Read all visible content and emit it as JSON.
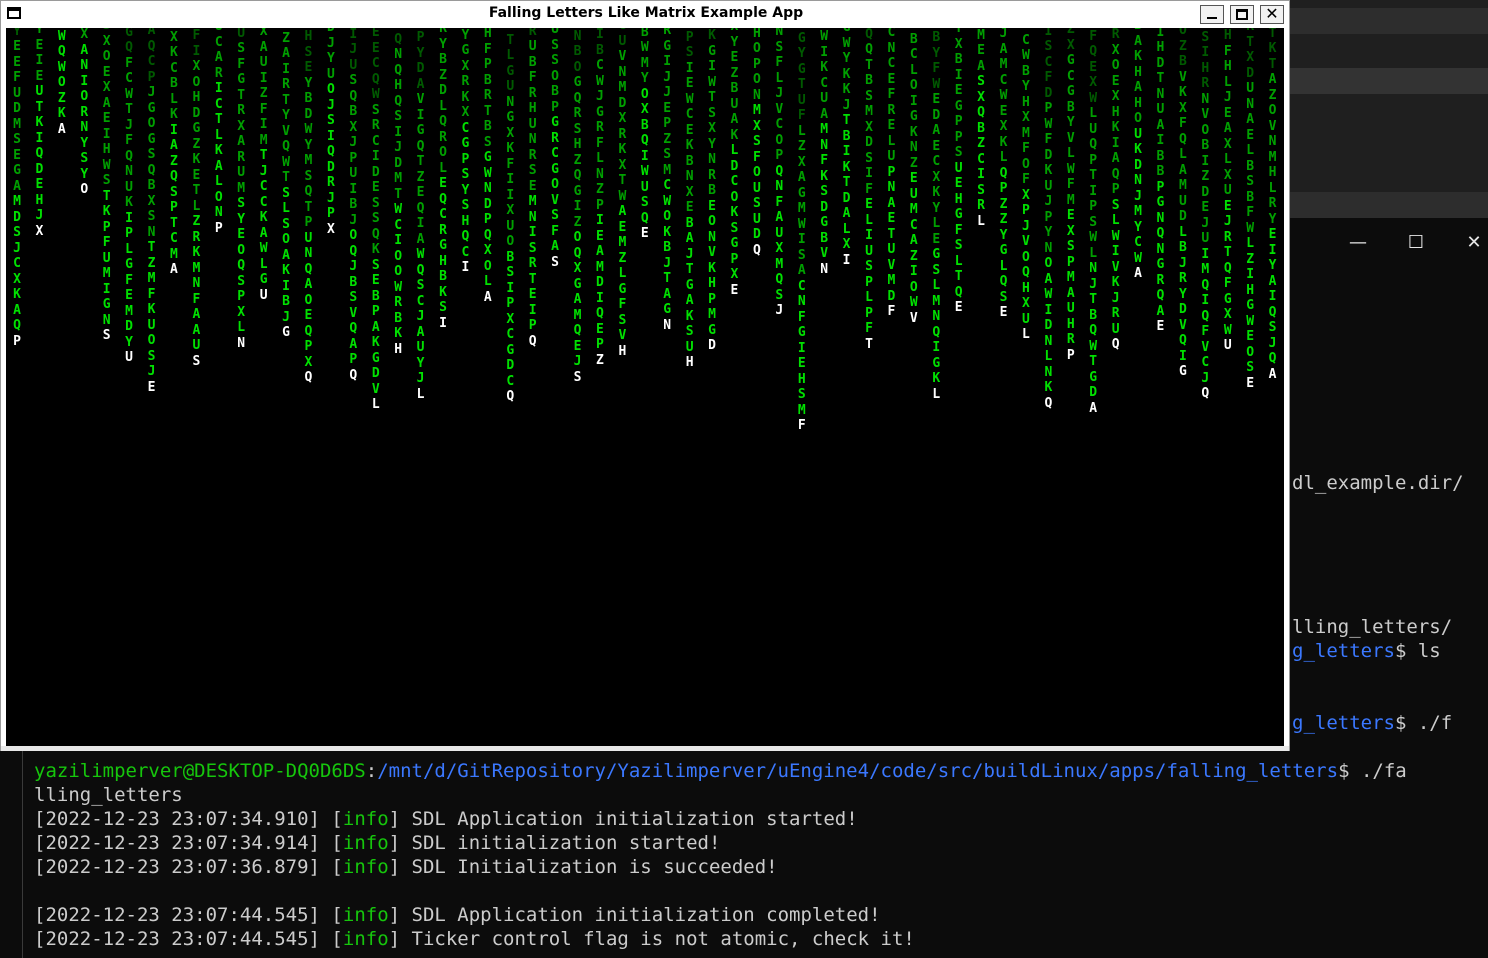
{
  "app_window": {
    "title": "Falling Letters Like Matrix Example App",
    "controls": {
      "minimize": "minimize",
      "maximize": "maximize",
      "close": "✕"
    }
  },
  "matrix": {
    "colors": {
      "head": "#ffffff",
      "bright": "#00e000",
      "mid": "#00a000",
      "dim": "#005a00",
      "background": "#000000"
    },
    "columns": [
      "SYEEFUDMSEGAMDSJCXKAQP",
      "YEIEUTKIQDEHJX",
      "JWQWOZKA",
      "XANIORNYSYO",
      "SXOEXAEIHWSTKPFUMIGNS",
      "KGQFCWTJFQNUKIPLGFEMDYU",
      "AQCPJGOGSQBXSNTZMFKUOSJE",
      "JXKCBLKIAZQSPTCMA",
      "FIXOHDGZKETLZRKMNFAAUS",
      "UCARICTLKALONP",
      "RUSFGTRXARUMSYEOQSPXLN",
      "XAUIZFIMTJCCKAWLGU",
      "OZAIRTYVQWTSLSOAKIBJG",
      "HSEYBDWYMSQTPUNQAOEQPXQ",
      "DJYUOJSIQDRJPX",
      "DIJUSQBXJPUIBJOQJBSVQAPQ",
      "EECQWSRCIDESSQKSEBPAKGDVL",
      "AQNQHQSIJDMTWCIOOWRBKH",
      "PYDAVIGQTZEQIAWQSCJAUYJL",
      "RYBZDLQROLEQCRGHBKSI",
      "FYGXRKXCGPSYSHQCI",
      "HFPBRTBSGWNDPQXOLA",
      "UTLGUNGXKFIIXUOBSIPXCGDCQ",
      "IRUBFRHUNRSEMNISRTEIPQ",
      "USSOBPGRCGOVSFAS",
      "DNBOGQRSHZQGIZOQXGAMQEJS",
      "IBCWJGRFLNZPIEAMDIQEPZ",
      "GUVNMDXRKXTWAEMZLGFSVH",
      "DBWMYOXBQIWUSQE",
      "RGIJJEPZSMCWOKBJTAGN",
      "DPSIEWCEKBNXEBAJTGAKSUH",
      "KGIWTSXYNRBEONVKHPMGD",
      "XYEZBUAKLDCOKSGPXE",
      "XHOPONMXSFOUSUDQ",
      "NSFLJVCOPQNFAUXMQSJ",
      "EGYGTUFLZXAGMWISACNFGIEHSMF",
      "WIKCUAMNFKSDGBVN",
      "GWYKKJTBIKTDALXI",
      "AQQTBSMXDSIFELIUSPLPFT",
      "CNCEFRELUPNAETUVMDF",
      "JBCLOIGKNZEUMCAZIOWV",
      "BYFWEDAECXKYLEGSLMNQIGKL",
      "YXBIEGPPSUEHGFSLTQE",
      "AMEASXQBZCISRL",
      "JAMCWEXKLQPZZYGLQSE",
      "JCWBYHXMFOFXPJVOQHXUL",
      "AISCFDPWFDKUJPYNOAWIDNLNKQ",
      "ZXGCGBYVLWFMEXSPMAUHRP",
      "GFQEXWLUQPTIPSWLNJTBQWTGDA",
      "RXOEXHKIAQPSLWIVKJRUQ",
      "BAKHAHOUKDNJMYCWA",
      "AIHDTNUAIBBPGNQNGRQAE",
      "OZBVKXFQLAMUDLBJRYDVQIG",
      "BSIHRNVOBIZDEJUIMQIQFVCJQ",
      "HFHLJEAXLXUEJRTQFGXWU",
      "RTXDUNAELBSBFWLZIHGWEOSE",
      "ETKTAZOVNMHLRYEIYAIQSJQA"
    ]
  },
  "terminal": {
    "window_controls": {
      "minimize": "—",
      "maximize": "☐",
      "close": "✕"
    },
    "partial_lines": [
      {
        "text": "dl_example.dir/"
      },
      {
        "text": "lling_letters/"
      },
      {
        "prefix": "g_letters",
        "suffix": "$ ls"
      },
      {
        "prefix": "g_letters",
        "suffix": "$ ./f"
      }
    ],
    "prompt": {
      "user_host": "yazilimperver@DESKTOP-DQ0D6DS",
      "path": "/mnt/d/GitRepository/Yazilimperver/uEngine4/code/src/buildLinux/apps/falling_letters",
      "command": "$ ./fa",
      "wrap": "lling_letters"
    },
    "logs": [
      {
        "timestamp": "[2022-12-23 23:07:34.910]",
        "level": "info",
        "message": "SDL Application initialization started!"
      },
      {
        "timestamp": "[2022-12-23 23:07:34.914]",
        "level": "info",
        "message": "SDL initialization started!"
      },
      {
        "timestamp": "[2022-12-23 23:07:36.879]",
        "level": "info",
        "message": "SDL Initialization is succeeded!"
      },
      {
        "timestamp": "[2022-12-23 23:07:44.545]",
        "level": "info",
        "message": "SDL Application initialization completed!"
      },
      {
        "timestamp": "[2022-12-23 23:07:44.545]",
        "level": "info",
        "message": "Ticker control flag is not atomic, check it!"
      }
    ]
  }
}
